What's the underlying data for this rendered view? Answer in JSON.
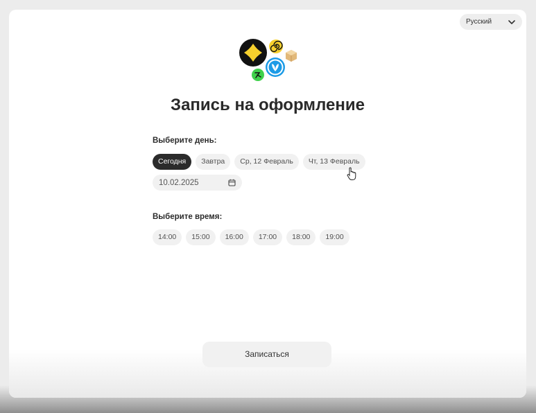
{
  "language": {
    "selected": "Русский",
    "icon": "chevron-down-icon"
  },
  "page": {
    "title": "Запись на оформление"
  },
  "day": {
    "label": "Выберите день:",
    "options": [
      {
        "label": "Сегодня",
        "selected": true
      },
      {
        "label": "Завтра",
        "selected": false
      },
      {
        "label": "Ср, 12 Февраль",
        "selected": false
      },
      {
        "label": "Чт, 13 Февраль",
        "selected": false
      }
    ],
    "date_value": "10.02.2025",
    "date_icon": "calendar-icon"
  },
  "time": {
    "label": "Выберите время:",
    "options": [
      "14:00",
      "15:00",
      "16:00",
      "17:00",
      "18:00",
      "19:00"
    ]
  },
  "submit": {
    "label": "Записаться"
  },
  "colors": {
    "accent_dark": "#2b2b2b",
    "chip_bg": "#f1f1f1",
    "logo_yellow": "#f6d02d",
    "logo_blue": "#1c9be6",
    "logo_green": "#3fd14b"
  }
}
